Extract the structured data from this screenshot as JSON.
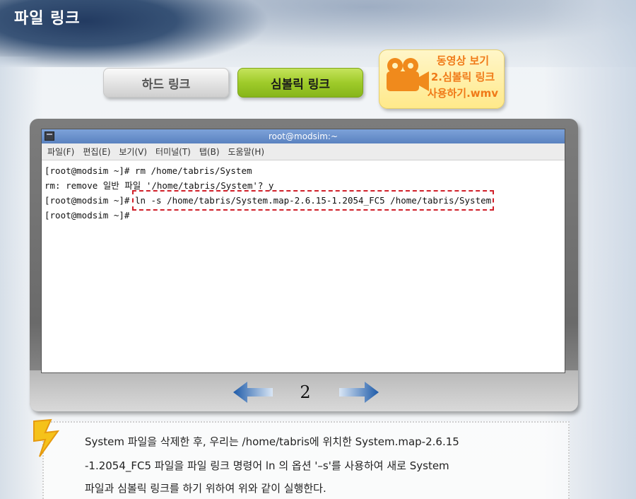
{
  "page": {
    "title": "파일 링크"
  },
  "tabs": [
    {
      "label": "하드 링크",
      "active": false
    },
    {
      "label": "심볼릭 링크",
      "active": true
    }
  ],
  "video": {
    "line1": "동영상 보기",
    "line2": "2.심볼릭 링크",
    "line3": "사용하기.wmv",
    "icon": "video-camera-icon"
  },
  "terminal": {
    "title": "root@modsim:~",
    "menu": [
      "파일(F)",
      "편집(E)",
      "보기(V)",
      "터미널(T)",
      "탭(B)",
      "도움말(H)"
    ],
    "lines": [
      "[root@modsim ~]# rm /home/tabris/System",
      "rm: remove 일반 파일 '/home/tabris/System'? y"
    ],
    "line3_prompt": "[root@modsim ~]# ",
    "line3_cmd": "ln -s /home/tabris/System.map-2.6.15-1.2054_FC5 /home/tabris/System",
    "line4": "[root@modsim ~]#",
    "highlight_color": "#d0202a"
  },
  "navigation": {
    "page_number": "2",
    "arrow_color": "#1d5aa8"
  },
  "note": {
    "icon": "lightning-icon",
    "lines": [
      "System 파일을 삭제한 후, 우리는 /home/tabris에 위치한 System.map-2.6.15",
      "-1.2054_FC5 파일을  파일 링크 명령어 ln 의 옵션 '–s'를 사용하여 새로 System",
      "파일과 심볼릭 링크를 하기 위하여 위와 같이 실행한다."
    ]
  },
  "colors": {
    "active_tab": "#9fcb2a",
    "video_text": "#f07a18",
    "title_bar": "#5a82c0"
  }
}
